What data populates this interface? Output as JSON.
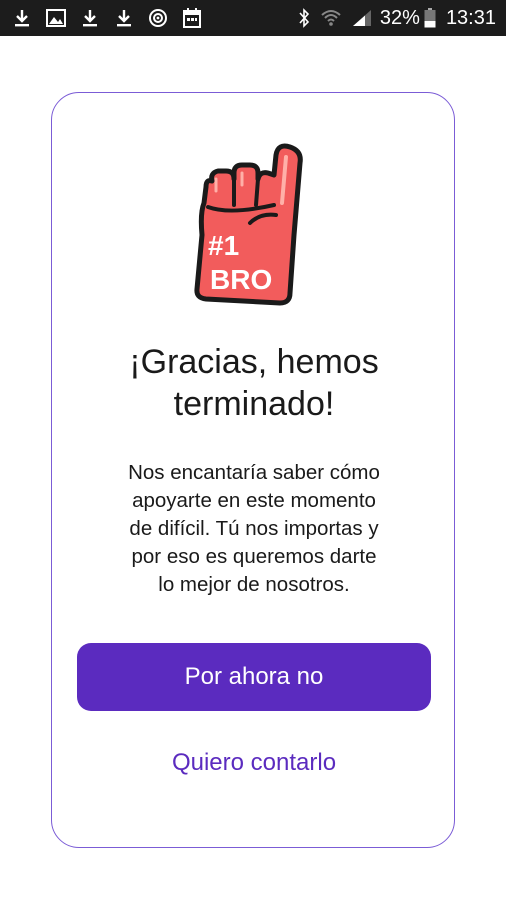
{
  "status_bar": {
    "battery": "32%",
    "time": "13:31",
    "left_icons": [
      "download-icon",
      "gallery-icon",
      "download-icon",
      "download-icon",
      "target-icon",
      "calendar-icon"
    ],
    "right_icons": [
      "bluetooth-icon",
      "wifi-icon",
      "signal-icon",
      "battery-icon"
    ]
  },
  "illustration": {
    "name": "foam-finger-icon",
    "text_line1": "#1",
    "text_line2": "BRO",
    "colors": {
      "fill": "#f25c5c",
      "outline": "#1a1a1a",
      "text": "#ffffff"
    }
  },
  "card": {
    "title_line1": "¡Gracias, hemos",
    "title_line2": "terminado!",
    "body_lines": [
      "Nos encantaría saber cómo",
      "apoyarte en este momento",
      "de difícil. Tú nos importas y",
      "por eso es queremos darte",
      "lo mejor de nosotros."
    ],
    "primary_button": "Por ahora no",
    "secondary_link": "Quiero contarlo"
  },
  "colors": {
    "accent": "#5b2bbf",
    "card_border": "#7b5cd6",
    "status_bar": "#1c1c1c"
  }
}
